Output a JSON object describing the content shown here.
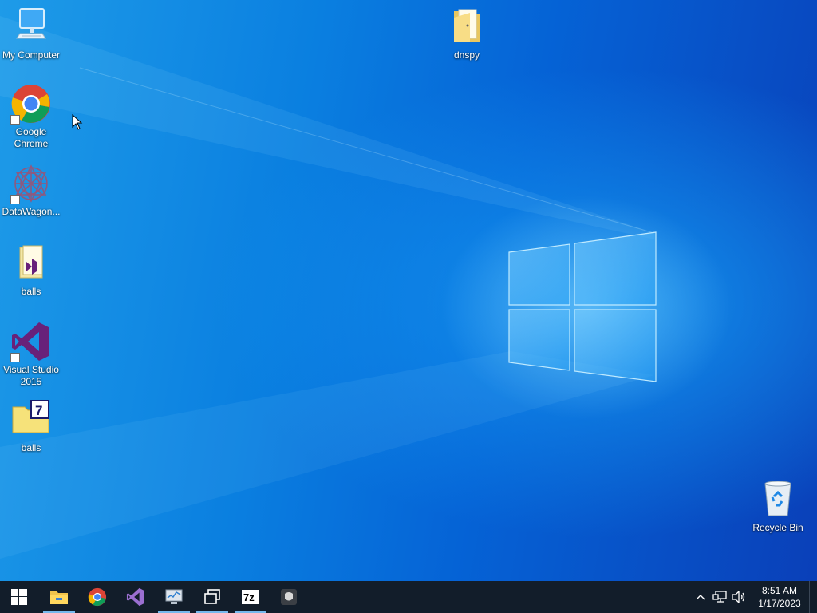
{
  "desktop": {
    "icons": [
      {
        "label_1": "My Computer",
        "label_2": ""
      },
      {
        "label_1": "Google",
        "label_2": "Chrome"
      },
      {
        "label_1": "DataWagon...",
        "label_2": ""
      },
      {
        "label_1": "balls",
        "label_2": ""
      },
      {
        "label_1": "Visual Studio",
        "label_2": "2015"
      },
      {
        "label_1": "balls",
        "label_2": ""
      },
      {
        "label_1": "dnspy",
        "label_2": ""
      },
      {
        "label_1": "Recycle Bin",
        "label_2": ""
      }
    ]
  },
  "taskbar": {
    "buttons": [
      {
        "icon": "windows-start-icon"
      },
      {
        "icon": "file-explorer-icon"
      },
      {
        "icon": "chrome-icon"
      },
      {
        "icon": "visual-studio-icon"
      },
      {
        "icon": "system-monitor-icon"
      },
      {
        "icon": "task-view-icon"
      },
      {
        "icon": "7zip-icon",
        "text": "7z"
      },
      {
        "icon": "generic-app-icon"
      }
    ],
    "clock": {
      "time": "8:51 AM",
      "date": "1/17/2023"
    }
  },
  "colors": {
    "taskbar_bg": "#121d2a",
    "active_indicator": "#76b9ed",
    "wallpaper_blue": "#0a7fe0"
  }
}
